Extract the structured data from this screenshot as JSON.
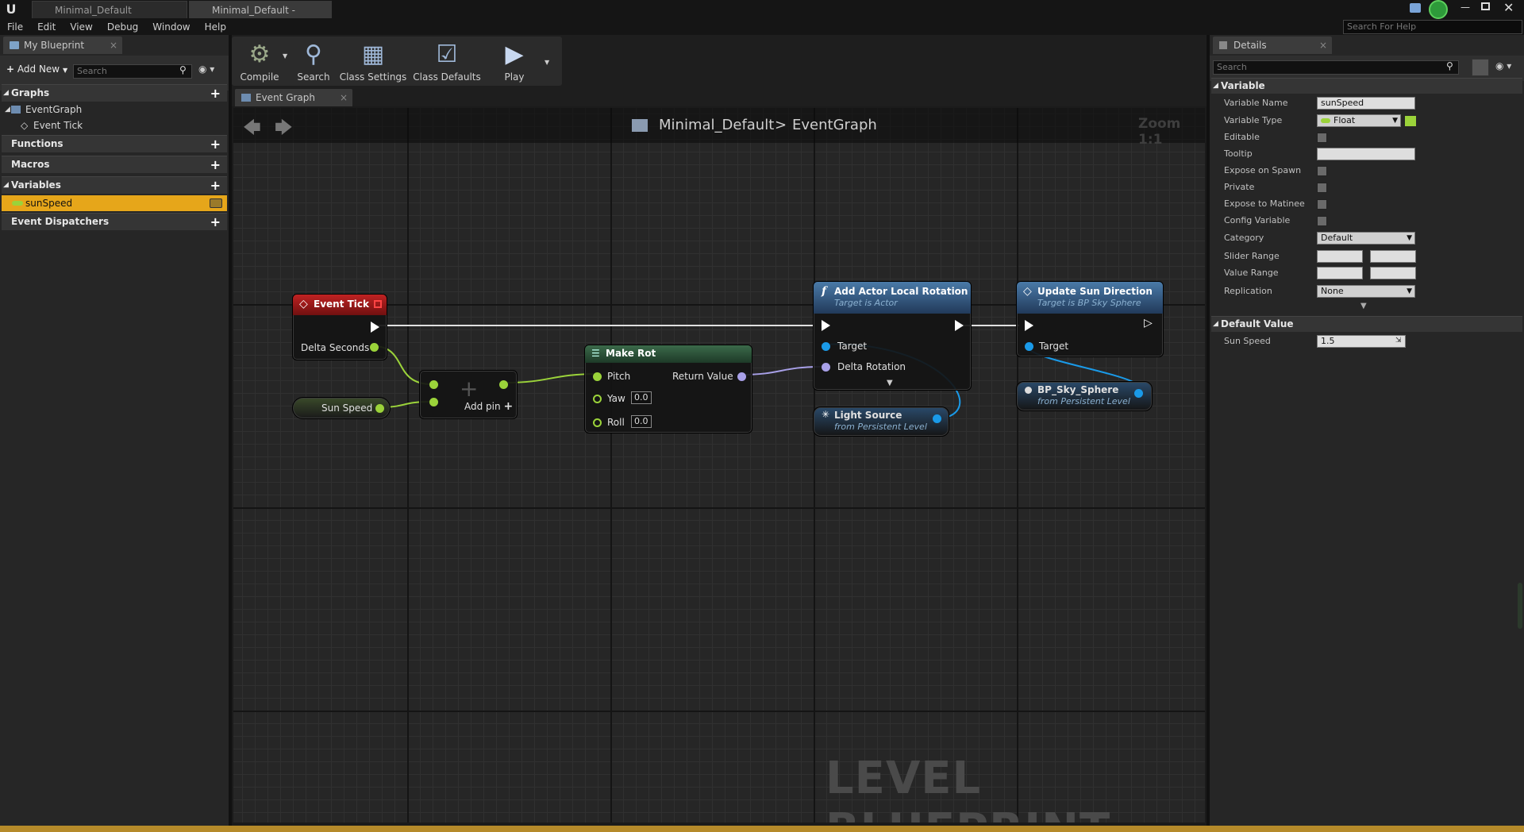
{
  "window": {
    "tabs": [
      {
        "label": "Minimal_Default"
      },
      {
        "label": "Minimal_Default - Level Bl"
      }
    ],
    "help_search_placeholder": "Search For Help"
  },
  "menu": [
    "File",
    "Edit",
    "View",
    "Debug",
    "Window",
    "Help"
  ],
  "my_blueprint": {
    "tab_label": "My Blueprint",
    "add_new_label": "Add New",
    "search_placeholder": "Search",
    "sections": {
      "graphs": "Graphs",
      "functions": "Functions",
      "macros": "Macros",
      "variables": "Variables",
      "dispatchers": "Event Dispatchers"
    },
    "graph_items": [
      "EventGraph",
      "Event Tick"
    ],
    "variables": [
      {
        "name": "sunSpeed",
        "color": "#9bd33a"
      }
    ]
  },
  "toolbar": {
    "compile": "Compile",
    "search": "Search",
    "class_settings": "Class Settings",
    "class_defaults": "Class Defaults",
    "play": "Play"
  },
  "graph": {
    "tab_label": "Event Graph",
    "breadcrumb_root": "Minimal_Default",
    "breadcrumb_sep": ">",
    "breadcrumb_leaf": "EventGraph",
    "zoom_label": "Zoom 1:1",
    "watermark": "LEVEL BLUEPRINT",
    "nodes": {
      "event_tick": {
        "title": "Event Tick",
        "pin": "Delta Seconds"
      },
      "sun_speed": {
        "label": "Sun Speed"
      },
      "add": {
        "add_pin": "Add pin"
      },
      "make_rot": {
        "title": "Make Rot",
        "pins": [
          "Pitch",
          "Yaw",
          "Roll"
        ],
        "yaw": "0.0",
        "roll": "0.0",
        "out": "Return Value"
      },
      "add_rotation": {
        "title": "Add Actor Local Rotation",
        "subtitle": "Target is Actor",
        "pins": [
          "Target",
          "Delta Rotation"
        ]
      },
      "update_sun": {
        "title": "Update Sun Direction",
        "subtitle": "Target is BP Sky Sphere",
        "pins": [
          "Target"
        ]
      },
      "light_source": {
        "title": "Light Source",
        "subtitle": "from Persistent Level"
      },
      "sky_sphere": {
        "title": "BP_Sky_Sphere",
        "subtitle": "from Persistent Level"
      }
    }
  },
  "details": {
    "tab_label": "Details",
    "search_placeholder": "Search",
    "section_variable": "Variable",
    "rows": {
      "variable_name": {
        "label": "Variable Name",
        "value": "sunSpeed"
      },
      "variable_type": {
        "label": "Variable Type",
        "value": "Float"
      },
      "editable": "Editable",
      "tooltip": "Tooltip",
      "expose_spawn": "Expose on Spawn",
      "private": "Private",
      "expose_matinee": "Expose to Matinee",
      "config": "Config Variable",
      "category": {
        "label": "Category",
        "value": "Default"
      },
      "slider_range": "Slider Range",
      "value_range": "Value Range",
      "replication": {
        "label": "Replication",
        "value": "None"
      }
    },
    "section_default": "Default Value",
    "default_row": {
      "label": "Sun Speed",
      "value": "1.5"
    }
  }
}
